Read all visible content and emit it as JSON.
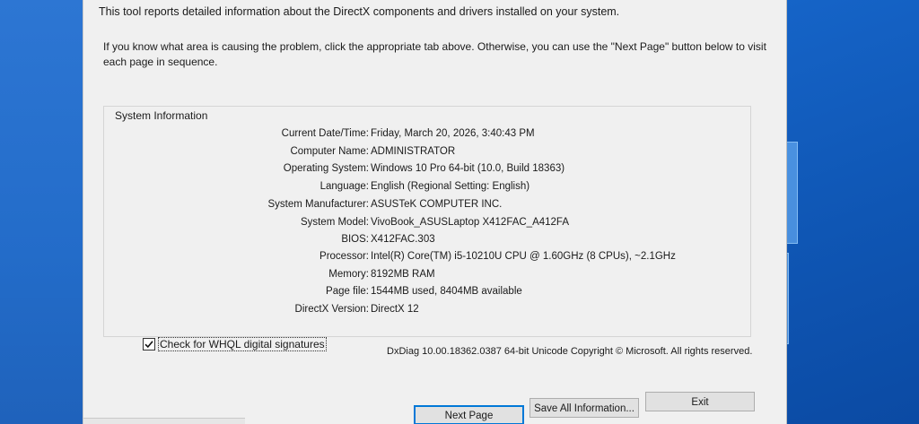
{
  "intro": {
    "line1": "This tool reports detailed information about the DirectX components and drivers installed on your system.",
    "line2": "If you know what area is causing the problem, click the appropriate tab above.  Otherwise, you can use the \"Next Page\" button below to visit each page in sequence."
  },
  "system_info": {
    "title": "System Information",
    "rows": [
      {
        "label": "Current Date/Time:",
        "value": "Friday, March 20, 2026, 3:40:43 PM"
      },
      {
        "label": "Computer Name:",
        "value": "ADMINISTRATOR"
      },
      {
        "label": "Operating System:",
        "value": "Windows 10 Pro 64-bit (10.0, Build 18363)"
      },
      {
        "label": "Language:",
        "value": "English (Regional Setting: English)"
      },
      {
        "label": "System Manufacturer:",
        "value": "ASUSTeK COMPUTER INC."
      },
      {
        "label": "System Model:",
        "value": "VivoBook_ASUSLaptop X412FAC_A412FA"
      },
      {
        "label": "BIOS:",
        "value": "X412FAC.303"
      },
      {
        "label": "Processor:",
        "value": "Intel(R) Core(TM) i5-10210U CPU @ 1.60GHz (8 CPUs), ~2.1GHz"
      },
      {
        "label": "Memory:",
        "value": "8192MB RAM"
      },
      {
        "label": "Page file:",
        "value": "1544MB used, 8404MB available"
      },
      {
        "label": "DirectX Version:",
        "value": "DirectX 12"
      }
    ]
  },
  "whql": {
    "label": "Check for WHQL digital signatures",
    "checked": true
  },
  "version_text": "DxDiag 10.00.18362.0387 64-bit Unicode  Copyright © Microsoft. All rights reserved.",
  "buttons": {
    "next_page": "Next Page",
    "save_all": "Save All Information...",
    "exit": "Exit"
  }
}
